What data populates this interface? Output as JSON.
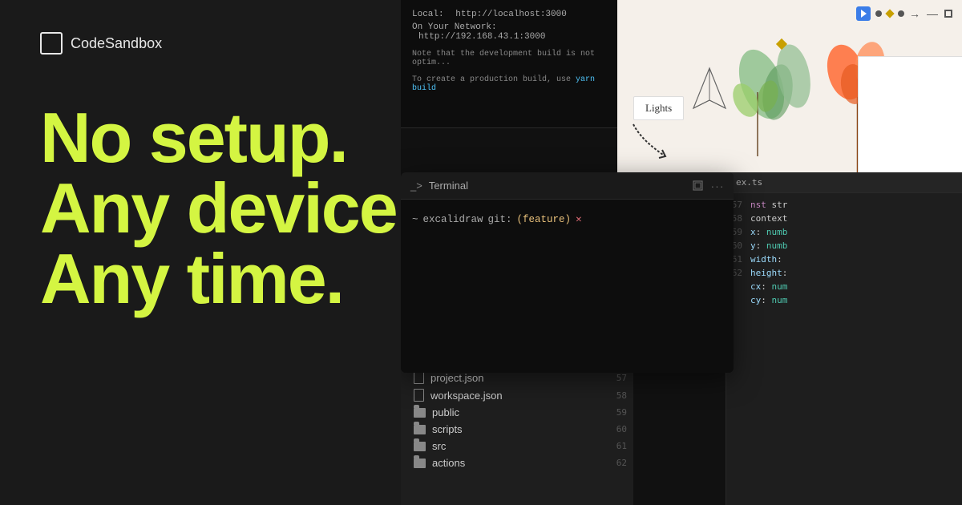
{
  "logo": {
    "text": "CodeSandbox"
  },
  "hero": {
    "line1": "No setup.",
    "line2": "Any device.",
    "line3": "Any time."
  },
  "topTerminal": {
    "line1_label": "Local:",
    "line1_url": "http://localhost:3000",
    "line2_label": "On Your Network:",
    "line2_url": "http://192.168.43.1:3000",
    "note1": "Note that the development build is not optim...",
    "note2": "To create a production build, use ",
    "yarn_build": "yarn build"
  },
  "mainTerminal": {
    "title": "Terminal",
    "prompt_tilde": "~",
    "prompt_dir": "excalidraw",
    "prompt_git_label": "git:",
    "prompt_branch": "(feature)",
    "prompt_x": "✕"
  },
  "designPanel": {
    "lights_button": "Lights"
  },
  "fileExplorer": {
    "files": [
      {
        "type": "doc",
        "name": "project.json",
        "line": "57"
      },
      {
        "type": "doc",
        "name": "workspace.json",
        "line": "58"
      },
      {
        "type": "folder",
        "name": "public",
        "line": "59"
      },
      {
        "type": "folder",
        "name": "scripts",
        "line": "60"
      },
      {
        "type": "folder",
        "name": "src",
        "line": "61"
      },
      {
        "type": "folder",
        "name": "actions",
        "line": "62"
      }
    ]
  },
  "codePanel": {
    "filename": "ex.ts",
    "lines": [
      {
        "num": "57",
        "content": "nst str"
      },
      {
        "num": "58",
        "content": "context"
      },
      {
        "num": "59",
        "prop": "x",
        "type": "numb"
      },
      {
        "num": "60",
        "prop": "y",
        "type": "numb"
      },
      {
        "num": "61",
        "prop": "width",
        "type": ""
      },
      {
        "num": "62",
        "prop": "height",
        "type": ""
      },
      {
        "num": "",
        "prop": "cx",
        "type": "num"
      },
      {
        "num": "",
        "prop": "cy",
        "type": "num"
      }
    ]
  },
  "toolbar": {
    "items": [
      "▶",
      "■",
      "◆",
      "●",
      "→",
      "—",
      "□"
    ]
  }
}
